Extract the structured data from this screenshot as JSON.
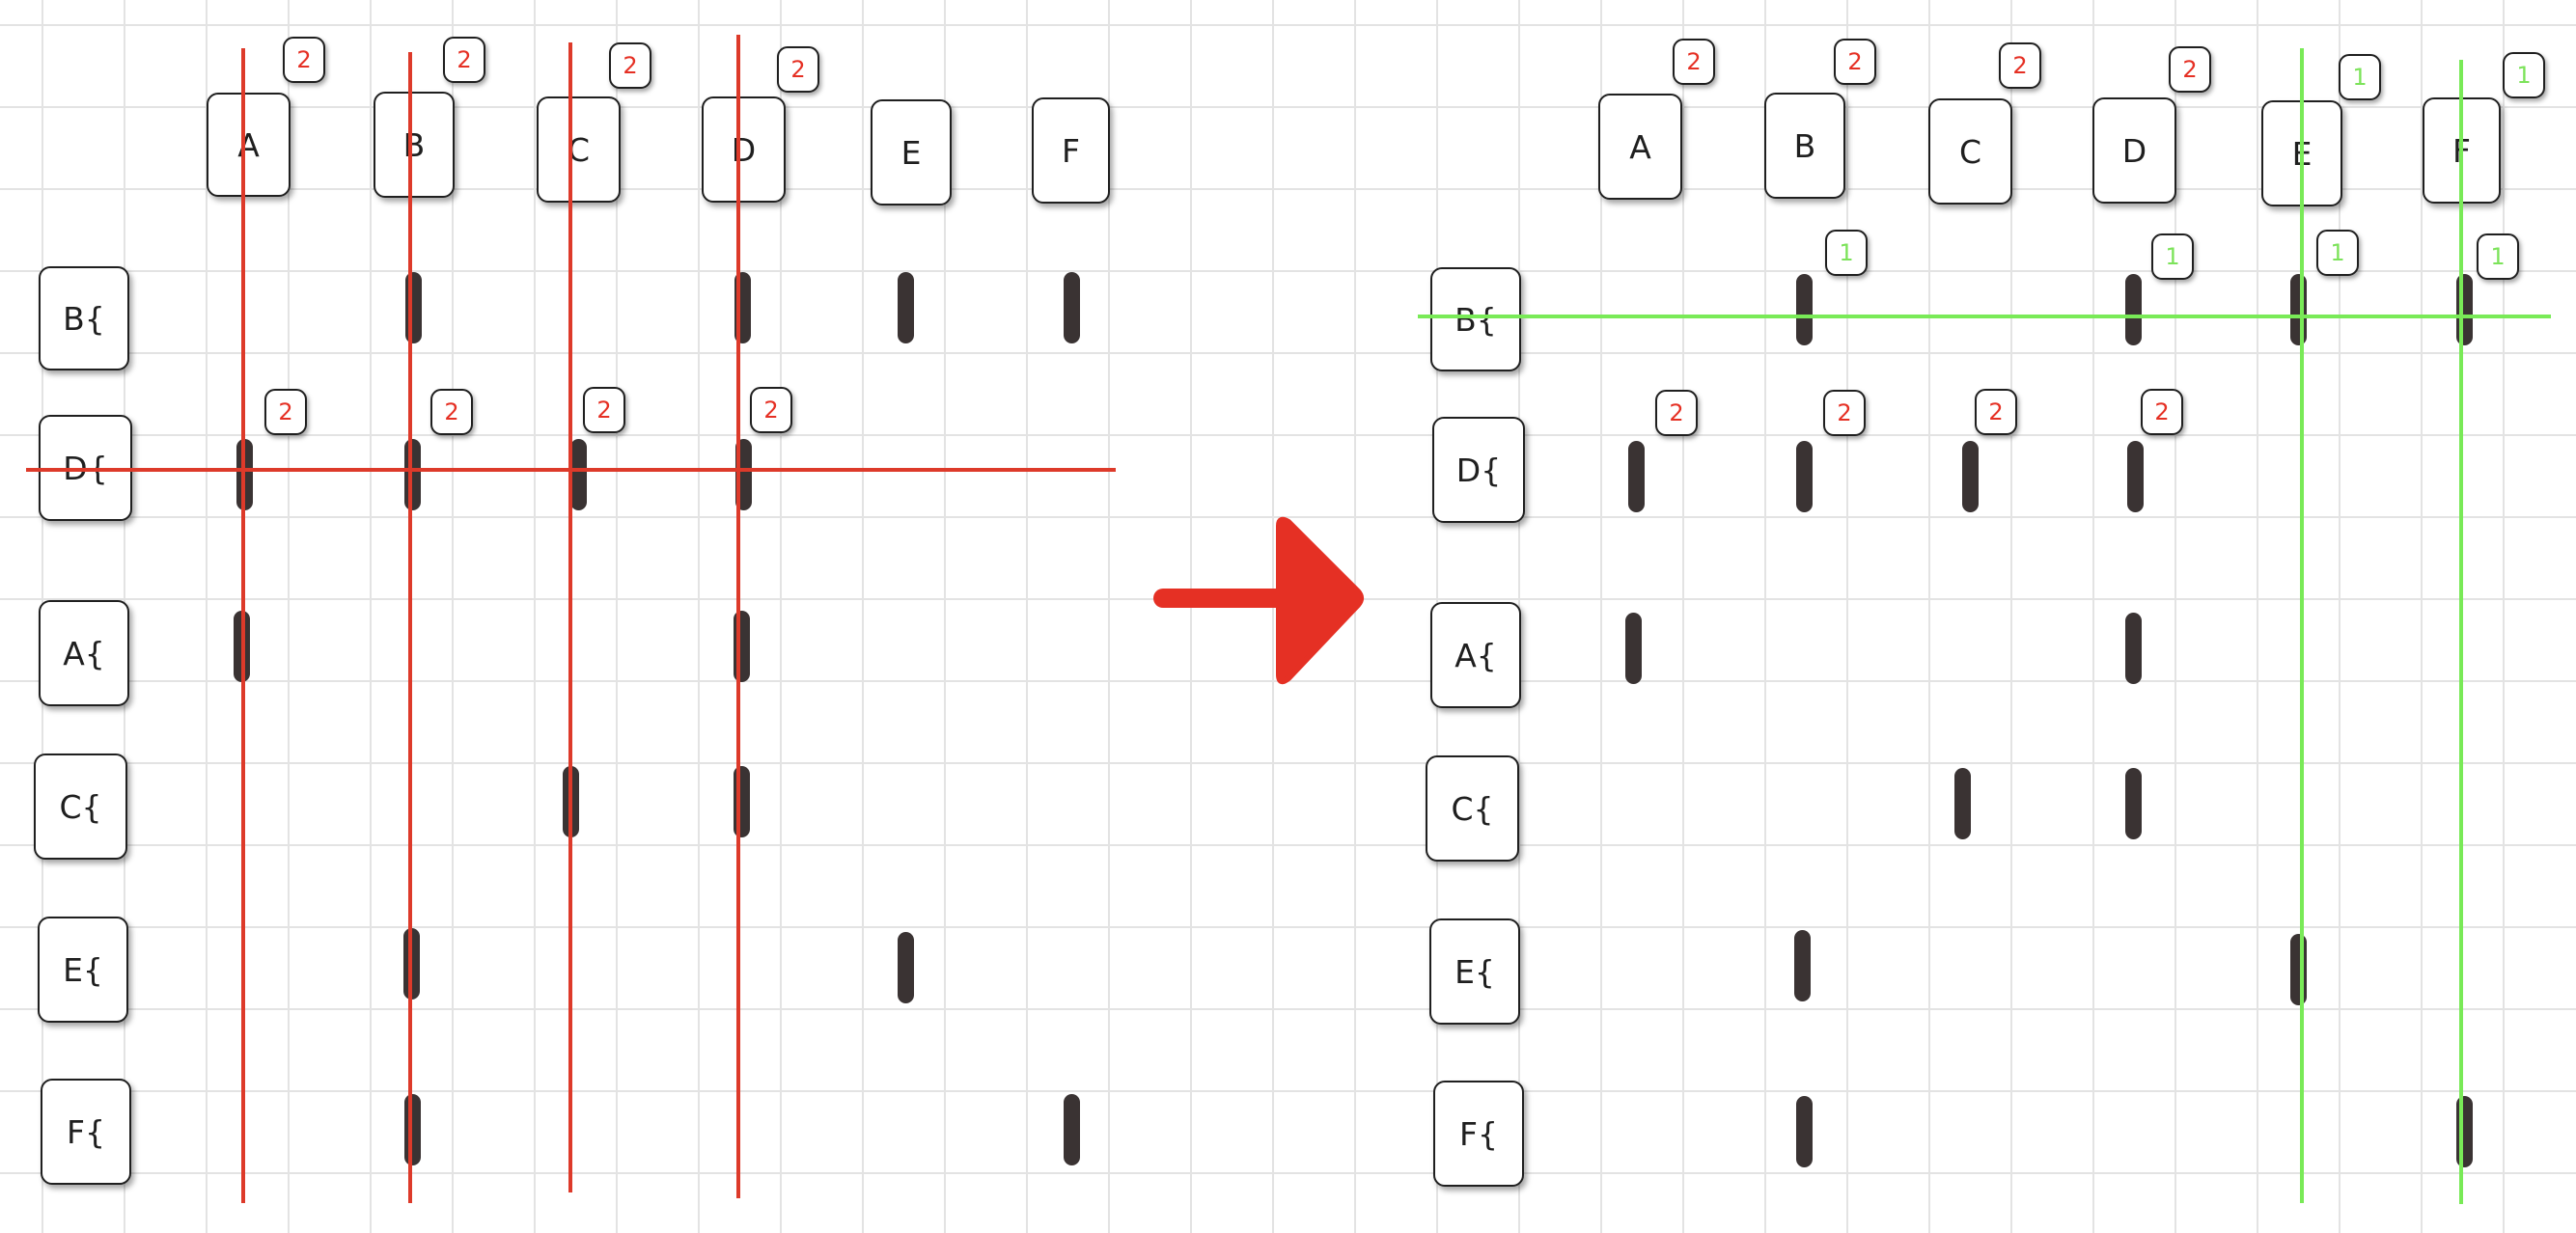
{
  "left": {
    "columns": [
      "A",
      "B",
      "C",
      "D",
      "E",
      "F"
    ],
    "rows": [
      "B{",
      "D{",
      "A{",
      "C{",
      "E{",
      "F{"
    ],
    "column_badges": [
      "2",
      "2",
      "2",
      "2"
    ],
    "row_badges": [
      "2",
      "2",
      "2",
      "2"
    ],
    "line_color": "#dd3a2a"
  },
  "right": {
    "columns": [
      "A",
      "B",
      "C",
      "D",
      "E",
      "F"
    ],
    "rows": [
      "B{",
      "D{",
      "A{",
      "C{",
      "E{",
      "F{"
    ],
    "column_badges": [
      "2",
      "2",
      "2",
      "2",
      "1",
      "1"
    ],
    "row_b_badges": [
      "1",
      "1",
      "1",
      "1"
    ],
    "row_d_badges": [
      "2",
      "2",
      "2",
      "2"
    ],
    "line_color": "#79ea57"
  },
  "marks": {
    "B{": [
      "B",
      "D",
      "E",
      "F"
    ],
    "D{": [
      "A",
      "B",
      "C",
      "D"
    ],
    "A{": [
      "A",
      "D"
    ],
    "C{": [
      "C",
      "D"
    ],
    "E{": [
      "B",
      "E"
    ],
    "F{": [
      "B",
      "F"
    ]
  },
  "arrow_color": "#e53024",
  "mark_color": "#3a3333"
}
